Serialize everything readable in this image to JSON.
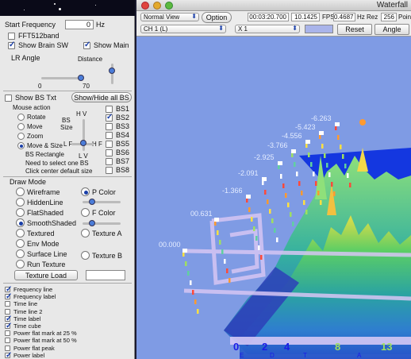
{
  "left": {
    "start_frequency": {
      "label": "Start Frequency",
      "value": "0",
      "unit": "Hz"
    },
    "checks_top": [
      {
        "label": "FFT512band",
        "checked": false
      },
      {
        "label": "Show Brain SW",
        "checked": true
      },
      {
        "label": "Show Main",
        "checked": true
      }
    ],
    "lr_angle": {
      "label": "LR Angle",
      "min": "0",
      "max": "70",
      "value": 70
    },
    "distance_label": "Distance",
    "show_bs_txt": {
      "label": "Show BS Txt",
      "checked": false
    },
    "show_hide_all_bs": "Show/Hide all BS",
    "mouse_action": {
      "title": "Mouse action",
      "options": [
        {
          "label": "Rotate",
          "selected": false
        },
        {
          "label": "Move",
          "selected": false
        },
        {
          "label": "Zoom",
          "selected": false
        },
        {
          "label": "Move & Size",
          "selected": true
        }
      ],
      "bs_rectangle": "BS Rectangle",
      "note1": "Need to select one BS",
      "note2": "Click center default size"
    },
    "bs_size": {
      "label_top": "BS",
      "label_bottom": "Size",
      "hv": "H V",
      "lf": "L F",
      "hf": "H F",
      "lv": "L V"
    },
    "bs_list": [
      {
        "label": "BS1",
        "checked": false
      },
      {
        "label": "BS2",
        "checked": true
      },
      {
        "label": "BS3",
        "checked": false
      },
      {
        "label": "BS4",
        "checked": false
      },
      {
        "label": "BS5",
        "checked": false
      },
      {
        "label": "BS6",
        "checked": false
      },
      {
        "label": "BS7",
        "checked": false
      },
      {
        "label": "BS8",
        "checked": false
      }
    ],
    "draw_mode": {
      "title": "Draw Mode",
      "left": [
        {
          "label": "Wireframe",
          "selected": false
        },
        {
          "label": "HiddenLine",
          "selected": false
        },
        {
          "label": "FlatShaded",
          "selected": false
        },
        {
          "label": "SmoothShaded",
          "selected": true
        },
        {
          "label": "Textured",
          "selected": false
        },
        {
          "label": "Env Mode",
          "selected": false
        },
        {
          "label": "Surface Line",
          "selected": false
        },
        {
          "label": "Run Texture",
          "selected": false
        }
      ],
      "right": [
        {
          "label": "P Color",
          "selected": true
        },
        {
          "label": "F Color",
          "selected": false
        },
        {
          "label": "Texture A",
          "selected": false
        },
        {
          "label": "Texture B",
          "selected": false
        }
      ],
      "texture_load": "Texture Load"
    },
    "bottom_checks": [
      {
        "label": "Frequency line",
        "checked": true
      },
      {
        "label": "Frequency label",
        "checked": true
      },
      {
        "label": "Time line",
        "checked": false
      },
      {
        "label": "Time line 2",
        "checked": false
      },
      {
        "label": "Time label",
        "checked": true
      },
      {
        "label": "Time cube",
        "checked": true
      },
      {
        "label": "Power flat mark at 25 %",
        "checked": false
      },
      {
        "label": "Power flat mark at 50 %",
        "checked": false
      },
      {
        "label": "Power flat peak",
        "checked": false
      },
      {
        "label": "Power label",
        "checked": true
      }
    ]
  },
  "window": {
    "title": "Waterfall",
    "view_select": "Normal View",
    "option_button": "Option",
    "time": "00:03:20.700",
    "fps_value": "10.1425",
    "fps_label": "FPS",
    "hz_value": "0.4687",
    "hz_label": "Hz Rez",
    "point_value": "256",
    "point_label": "Poin",
    "channel_select": "CH 1 (L)",
    "scale_select": "X 1",
    "reset_button": "Reset",
    "angle_button": "Angle"
  },
  "plot": {
    "time_labels": [
      "-6.263",
      "-5.423",
      "-4.556",
      "-3.766",
      "-2.925",
      "-2.091",
      "-1.366",
      "00.631",
      "00.000"
    ],
    "freq_labels": [
      "0",
      "2",
      "4",
      "8",
      "13"
    ],
    "freq_letters": [
      "E",
      "D",
      "T",
      "A"
    ],
    "colors": {
      "background": "#7f9be4",
      "axis_text": "#1b1be6",
      "time_text": "#d8e4ff"
    }
  }
}
